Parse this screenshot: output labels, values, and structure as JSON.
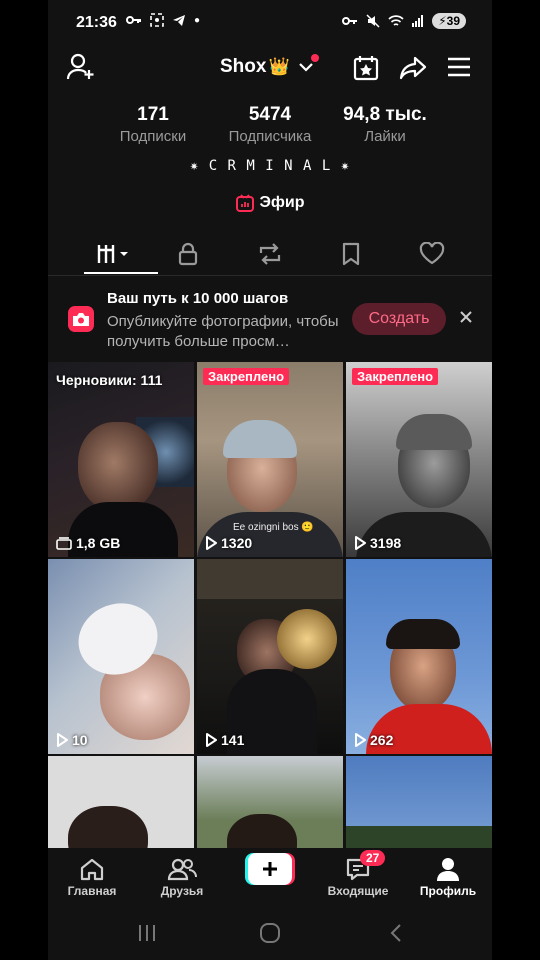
{
  "status_bar": {
    "time": "21:36",
    "battery": "39"
  },
  "header": {
    "username": "Shox",
    "crown": "👑"
  },
  "stats": [
    {
      "value": "171",
      "label": "Подписки"
    },
    {
      "value": "5474",
      "label": "Подписчика"
    },
    {
      "value": "94,8 тыс.",
      "label": "Лайки"
    }
  ],
  "bio": "✷ C R M I N A L ✷",
  "live_label": "Эфир",
  "banner": {
    "title": "Ваш путь к 10 000 шагов",
    "subtitle": "Опубликуйте фотографии, чтобы получить больше просм…",
    "create_label": "Создать"
  },
  "grid": {
    "drafts_label": "Черновики: 111",
    "drafts_size": "1,8 GB",
    "pinned_label": "Закреплено",
    "caption_2": "Ee ozingni bos 🙂",
    "views": [
      "1320",
      "3198",
      "10",
      "141",
      "262"
    ]
  },
  "bottom_nav": {
    "home": "Главная",
    "friends": "Друзья",
    "inbox": "Входящие",
    "inbox_count": "27",
    "profile": "Профиль"
  },
  "colors": {
    "accent": "#fe2c55",
    "background": "#121212"
  }
}
